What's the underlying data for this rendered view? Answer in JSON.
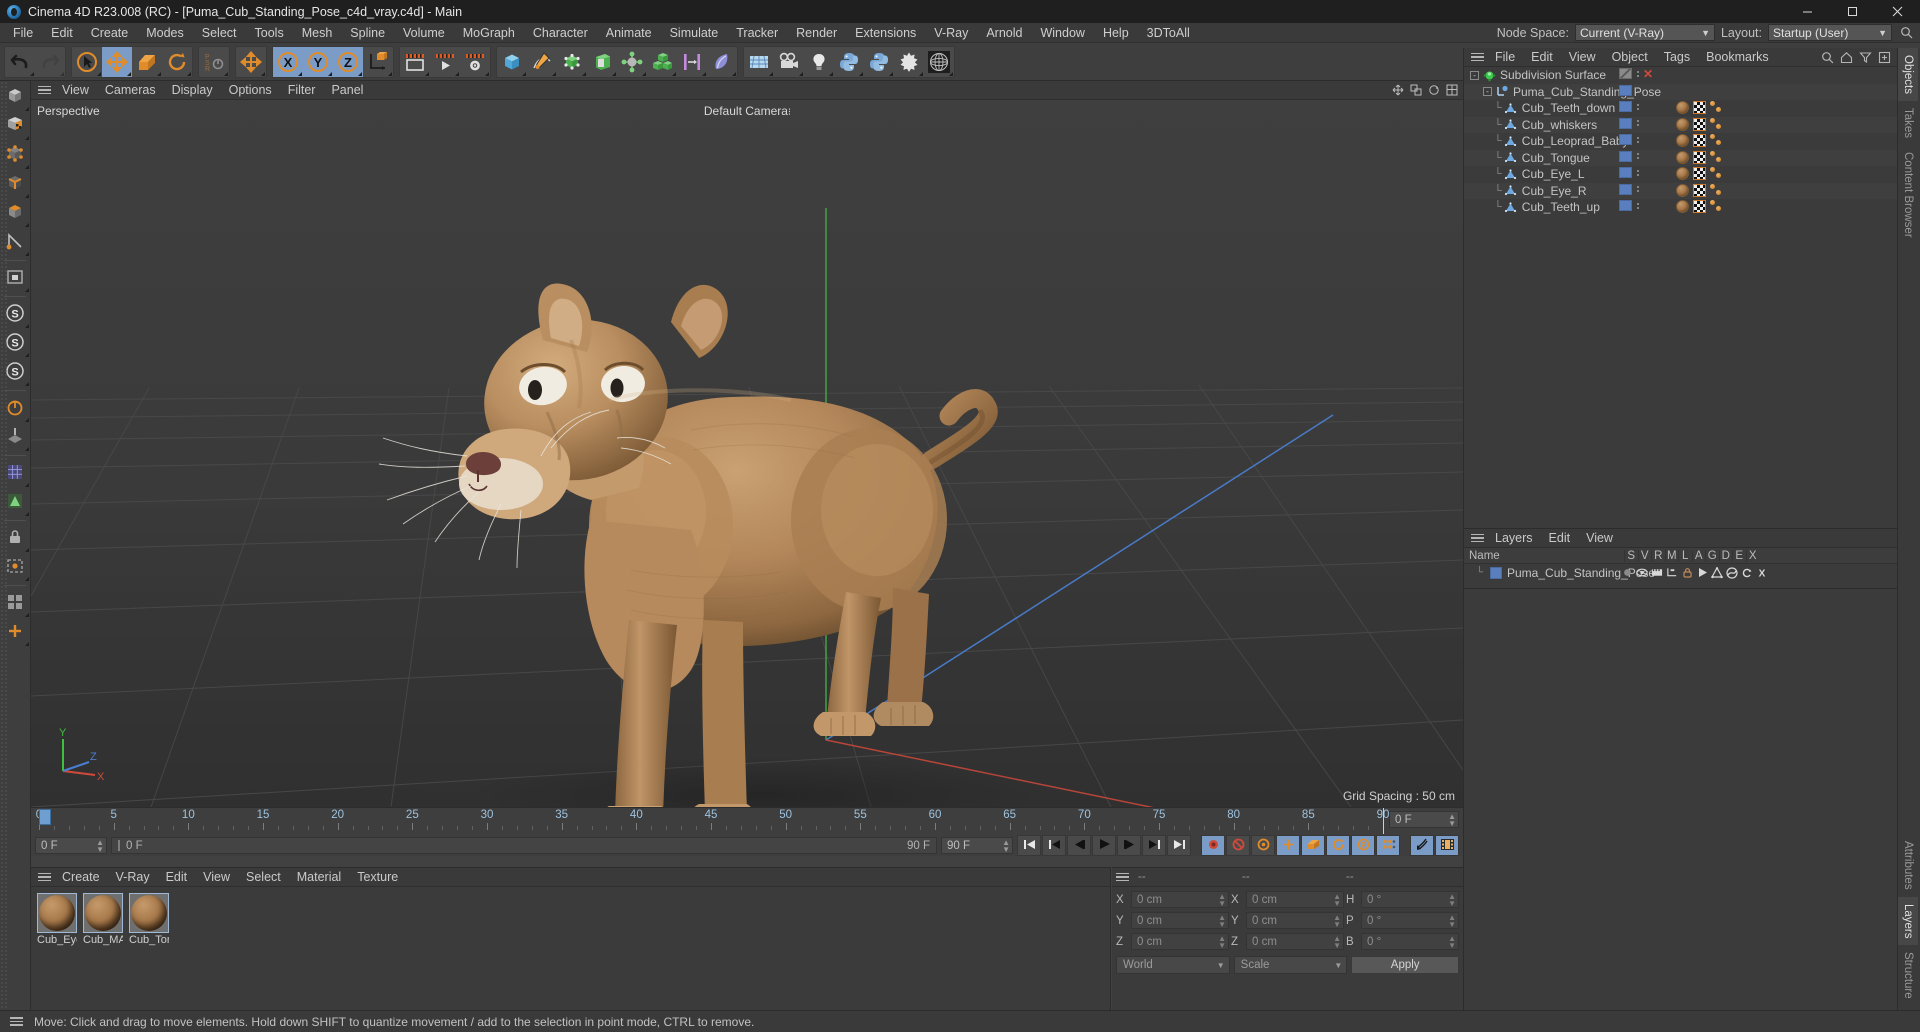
{
  "window": {
    "title": "Cinema 4D R23.008 (RC) - [Puma_Cub_Standing_Pose_c4d_vray.c4d] - Main",
    "app_icon": "cinema4d-logo-icon",
    "minimize": "minimize-icon",
    "maximize": "maximize-icon",
    "close": "close-icon"
  },
  "menubar": {
    "items": [
      "File",
      "Edit",
      "Create",
      "Modes",
      "Select",
      "Tools",
      "Mesh",
      "Spline",
      "Volume",
      "MoGraph",
      "Character",
      "Animate",
      "Simulate",
      "Tracker",
      "Render",
      "Extensions",
      "V-Ray",
      "Arnold",
      "Window",
      "Help",
      "3DToAll"
    ],
    "node_space_label": "Node Space:",
    "node_space_value": "Current (V-Ray)",
    "layout_label": "Layout:",
    "layout_value": "Startup (User)"
  },
  "toolbar": {
    "groups": [
      {
        "buttons": [
          {
            "name": "undo-button",
            "icon": "undo-arrow-icon",
            "state": "normal"
          },
          {
            "name": "redo-button",
            "icon": "redo-arrow-icon",
            "state": "disabled"
          }
        ]
      },
      {
        "buttons": [
          {
            "name": "live-selection-button",
            "icon": "cursor-circle-icon",
            "state": "normal"
          },
          {
            "name": "move-tool-button",
            "icon": "move-arrows-icon",
            "state": "active"
          },
          {
            "name": "scale-tool-button",
            "icon": "scale-box-icon",
            "state": "normal"
          },
          {
            "name": "rotate-tool-button",
            "icon": "rotate-circle-icon",
            "state": "normal"
          }
        ]
      },
      {
        "buttons": [
          {
            "name": "psr-lock-button",
            "icon": "psr-lock-icon",
            "state": "normal"
          }
        ]
      },
      {
        "buttons": [
          {
            "name": "move-duplicate-button",
            "icon": "move-arrows-icon",
            "state": "normal"
          }
        ]
      },
      {
        "buttons": [
          {
            "name": "axis-x-button",
            "icon": "x-axis-icon",
            "state": "active"
          },
          {
            "name": "axis-y-button",
            "icon": "y-axis-icon",
            "state": "active"
          },
          {
            "name": "axis-z-button",
            "icon": "z-axis-icon",
            "state": "active"
          },
          {
            "name": "world-object-axis-button",
            "icon": "world-axis-cube-icon",
            "state": "normal"
          }
        ]
      },
      {
        "buttons": [
          {
            "name": "render-view-button",
            "icon": "render-frame-icon",
            "state": "normal"
          },
          {
            "name": "render-to-picture-viewer-button",
            "icon": "render-play-icon",
            "state": "normal"
          },
          {
            "name": "render-settings-button",
            "icon": "render-gear-icon",
            "state": "normal"
          }
        ]
      },
      {
        "buttons": [
          {
            "name": "add-cube-button",
            "icon": "blue-cube-icon",
            "state": "normal"
          },
          {
            "name": "add-spline-button",
            "icon": "pen-spline-icon",
            "state": "normal"
          },
          {
            "name": "add-generator-button",
            "icon": "green-cube-points-icon",
            "state": "normal"
          },
          {
            "name": "add-array-button",
            "icon": "green-open-box-icon",
            "state": "normal"
          },
          {
            "name": "add-deformer-button",
            "icon": "bend-deformer-icon",
            "state": "normal"
          },
          {
            "name": "add-cloner-button",
            "icon": "three-cubes-icon",
            "state": "normal"
          },
          {
            "name": "add-effector-button",
            "icon": "effector-bars-icon",
            "state": "normal"
          },
          {
            "name": "add-field-button",
            "icon": "field-leaf-icon",
            "state": "normal"
          }
        ]
      },
      {
        "buttons": [
          {
            "name": "add-floor-button",
            "icon": "floor-grid-icon",
            "state": "normal"
          },
          {
            "name": "add-camera-button",
            "icon": "camera-icon",
            "state": "normal"
          },
          {
            "name": "add-light-button",
            "icon": "light-bulb-icon",
            "state": "normal"
          },
          {
            "name": "python-script-button",
            "icon": "python-icon",
            "state": "normal"
          },
          {
            "name": "python-generator-button",
            "icon": "python-icon",
            "state": "normal"
          },
          {
            "name": "simulate-particles-button",
            "icon": "particle-star-icon",
            "state": "normal"
          },
          {
            "name": "sky-button",
            "icon": "globe-wireframe-icon",
            "state": "normal"
          }
        ]
      }
    ]
  },
  "left_toolbar": {
    "buttons": [
      {
        "name": "model-mode-button",
        "icon": "model-mode-icon"
      },
      {
        "name": "texture-mode-button",
        "icon": "texture-mode-icon"
      },
      {
        "name": "points-mode-button",
        "icon": "points-mode-icon"
      },
      {
        "name": "edges-mode-button",
        "icon": "edges-mode-icon"
      },
      {
        "name": "polygons-mode-button",
        "icon": "polygons-mode-icon"
      },
      {
        "name": "enable-axis-button",
        "icon": "axis-modify-icon"
      },
      {
        "name": "viewport-solo-button",
        "icon": "viewport-solo-icon"
      },
      {
        "name": "snap-toggle-button",
        "icon": "snap-s-icon"
      },
      {
        "name": "quantize-button",
        "icon": "quantize-s-icon"
      },
      {
        "name": "workplane-button",
        "icon": "workplane-s-icon"
      },
      {
        "name": "lock-workplane-button",
        "icon": "lock-workplane-icon"
      },
      {
        "name": "align-workplane-button",
        "icon": "align-workplane-icon"
      },
      {
        "name": "uv-point-mode-button",
        "icon": "uv-grid-icon"
      },
      {
        "name": "uv-polygon-mode-button",
        "icon": "uv-polygon-icon"
      },
      {
        "name": "layout-lock-button",
        "icon": "layout-lock-icon"
      },
      {
        "name": "render-region-button",
        "icon": "render-region-icon"
      },
      {
        "name": "content-browser-button",
        "icon": "content-browser-icon"
      },
      {
        "name": "add-node-button",
        "icon": "plus-node-icon"
      }
    ]
  },
  "viewport": {
    "menu": [
      "View",
      "Cameras",
      "Display",
      "Options",
      "Filter",
      "Panel"
    ],
    "projection_label": "Perspective",
    "camera_label": "Default Camera",
    "grid_spacing_label": "Grid Spacing : 50 cm",
    "axis_gizmo": {
      "x": "X",
      "y": "Y",
      "z": "Z"
    },
    "panel_icons": [
      "move-view-icon",
      "scale-view-icon",
      "rotate-view-icon",
      "maximize-view-icon"
    ]
  },
  "timeline": {
    "ticks": [
      0,
      5,
      10,
      15,
      20,
      25,
      30,
      35,
      40,
      45,
      50,
      55,
      60,
      65,
      70,
      75,
      80,
      85,
      90
    ],
    "min_frame": 0,
    "max_frame": 90,
    "current_frame_field": "0 F",
    "current_frame_long": "0 F",
    "end_frame_small": "90 F",
    "end_frame_field": "90 F",
    "right_frame_field": "0 F",
    "transport": [
      {
        "name": "go-to-start-button",
        "icon": "skip-start-icon"
      },
      {
        "name": "go-to-previous-key-button",
        "icon": "prev-key-icon"
      },
      {
        "name": "step-back-button",
        "icon": "step-back-icon"
      },
      {
        "name": "play-button",
        "icon": "play-icon"
      },
      {
        "name": "step-forward-button",
        "icon": "step-forward-icon"
      },
      {
        "name": "go-to-next-key-button",
        "icon": "next-key-icon"
      },
      {
        "name": "go-to-end-button",
        "icon": "skip-end-icon"
      }
    ],
    "record_tools": [
      {
        "name": "record-active-objects-button",
        "icon": "record-key-icon",
        "state": "on"
      },
      {
        "name": "autokeying-button",
        "icon": "autokey-circle-icon",
        "state": "normal"
      },
      {
        "name": "keyframe-selection-button",
        "icon": "keyframe-gear-icon",
        "state": "normal"
      },
      {
        "name": "position-key-button",
        "icon": "position-key-icon",
        "state": "on"
      },
      {
        "name": "scale-key-button",
        "icon": "scale-key-icon",
        "state": "on"
      },
      {
        "name": "rotation-key-button",
        "icon": "rotation-key-icon",
        "state": "on"
      },
      {
        "name": "param-key-button",
        "icon": "param-key-icon",
        "state": "on"
      },
      {
        "name": "point-level-animation-button",
        "icon": "pla-dots-icon",
        "state": "on"
      }
    ],
    "extra_tools": [
      {
        "name": "sound-button",
        "icon": "sound-wave-icon",
        "state": "on"
      },
      {
        "name": "film-strip-button",
        "icon": "film-strip-icon",
        "state": "on"
      }
    ]
  },
  "material_manager": {
    "menu": [
      "Create",
      "V-Ray",
      "Edit",
      "View",
      "Select",
      "Material",
      "Texture"
    ],
    "materials": [
      {
        "name": "Cub_Eye",
        "selected": true
      },
      {
        "name": "Cub_MA",
        "selected": true
      },
      {
        "name": "Cub_Ton",
        "selected": true
      }
    ]
  },
  "coordinates_manager": {
    "headers": [
      "--",
      "--",
      "--"
    ],
    "rows": [
      {
        "axis1": "X",
        "value1": "0 cm",
        "axis2": "X",
        "value2": "0 cm",
        "axis3": "H",
        "value3": "0 °"
      },
      {
        "axis1": "Y",
        "value1": "0 cm",
        "axis2": "Y",
        "value2": "0 cm",
        "axis3": "P",
        "value3": "0 °"
      },
      {
        "axis1": "Z",
        "value1": "0 cm",
        "axis2": "Z",
        "value2": "0 cm",
        "axis3": "B",
        "value3": "0 °"
      }
    ],
    "coord_system": "World",
    "size_mode": "Scale",
    "apply_label": "Apply"
  },
  "object_manager": {
    "menu": [
      "File",
      "Edit",
      "View",
      "Object",
      "Tags",
      "Bookmarks"
    ],
    "tools": [
      "search-icon",
      "home-icon",
      "filter-icon",
      "new-layer-icon"
    ],
    "tree": [
      {
        "name": "Subdivision Surface",
        "depth": 0,
        "icon": "subdivision-surface-icon",
        "expander": "-",
        "chip": "gray",
        "has_x": true,
        "tags": []
      },
      {
        "name": "Puma_Cub_Standing_Pose",
        "depth": 1,
        "icon": "null-object-icon",
        "expander": "-",
        "chip": "blue",
        "has_x": false,
        "tags": []
      },
      {
        "name": "Cub_Teeth_down",
        "depth": 2,
        "icon": "polygon-object-icon",
        "expander": "",
        "chip": "blue",
        "has_x": false,
        "tags": [
          "material",
          "uv",
          "selection"
        ]
      },
      {
        "name": "Cub_whiskers",
        "depth": 2,
        "icon": "polygon-object-icon",
        "expander": "",
        "chip": "blue",
        "has_x": false,
        "tags": [
          "material",
          "uv",
          "selection"
        ]
      },
      {
        "name": "Cub_Leoprad_Baby",
        "depth": 2,
        "icon": "polygon-object-icon",
        "expander": "",
        "chip": "blue",
        "has_x": false,
        "tags": [
          "material",
          "uv",
          "selection"
        ]
      },
      {
        "name": "Cub_Tongue",
        "depth": 2,
        "icon": "polygon-object-icon",
        "expander": "",
        "chip": "blue",
        "has_x": false,
        "tags": [
          "material",
          "uv",
          "selection"
        ]
      },
      {
        "name": "Cub_Eye_L",
        "depth": 2,
        "icon": "polygon-object-icon",
        "expander": "",
        "chip": "blue",
        "has_x": false,
        "tags": [
          "material",
          "uv",
          "selection"
        ]
      },
      {
        "name": "Cub_Eye_R",
        "depth": 2,
        "icon": "polygon-object-icon",
        "expander": "",
        "chip": "blue",
        "has_x": false,
        "tags": [
          "material",
          "uv",
          "selection"
        ]
      },
      {
        "name": "Cub_Teeth_up",
        "depth": 2,
        "icon": "polygon-object-icon",
        "expander": "",
        "chip": "blue",
        "has_x": false,
        "tags": [
          "material",
          "uv",
          "selection"
        ]
      }
    ]
  },
  "layer_manager": {
    "menu": [
      "Layers",
      "Edit",
      "View"
    ],
    "name_header": "Name",
    "columns": [
      "S",
      "V",
      "R",
      "M",
      "L",
      "A",
      "G",
      "D",
      "E",
      "X"
    ],
    "rows": [
      {
        "name": "Puma_Cub_Standing_Pose",
        "color": "#5a7fbf"
      }
    ]
  },
  "vertical_tabs": {
    "top": [
      "Objects",
      "Takes",
      "Content Browser"
    ],
    "bottom": [
      "Attributes",
      "Layers",
      "Structure"
    ],
    "active_top": "Objects",
    "active_bottom": "Layers"
  },
  "statusbar": {
    "message": "Move: Click and drag to move elements. Hold down SHIFT to quantize movement / add to the selection in point mode, CTRL to remove."
  },
  "colors": {
    "accent_blue": "#7a9cc6",
    "accent_orange": "#d78b2e",
    "axis_x": "#d04a3a",
    "axis_y": "#4aaa4a",
    "axis_z": "#4a7fd0",
    "panel_bg": "#3b3b3b",
    "toolbar_bg": "#3e3e3e",
    "titlebar_bg": "#1f1f1f"
  }
}
